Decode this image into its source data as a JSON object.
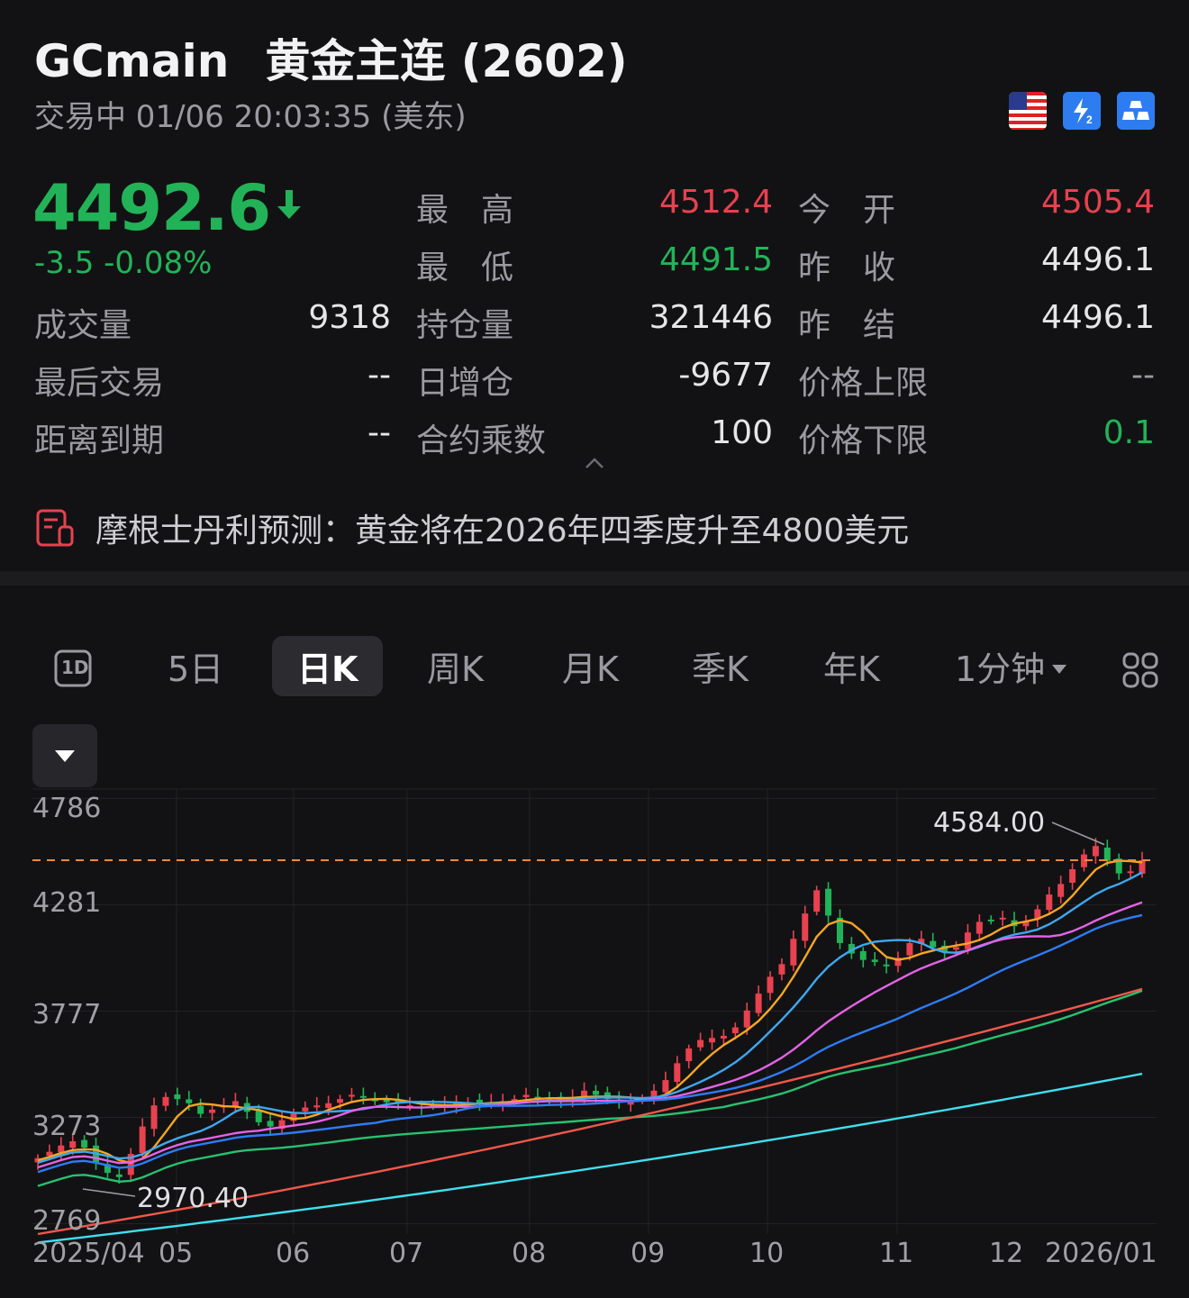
{
  "header": {
    "symbol": "GCmain",
    "name": "黄金主连 (2602)",
    "status_text": "交易中 01/06 20:03:35 (美东)",
    "badges": [
      "us-flag-icon",
      "level2-icon",
      "gold-bars-icon"
    ]
  },
  "quote": {
    "price": "4492.6",
    "change": "-3.5 -0.08%",
    "rows": {
      "high_label": "最　高",
      "high_value": "4512.4",
      "open_label": "今　开",
      "open_value": "4505.4",
      "low_label": "最　低",
      "low_value": "4491.5",
      "prevclose_label": "昨　收",
      "prevclose_value": "4496.1",
      "volume_label": "成交量",
      "volume_value": "9318",
      "oi_label": "持仓量",
      "oi_value": "321446",
      "prevsettle_label": "昨　结",
      "prevsettle_value": "4496.1",
      "lasttrade_label": "最后交易",
      "lasttrade_value": "--",
      "oichange_label": "日增仓",
      "oichange_value": "-9677",
      "upper_label": "价格上限",
      "upper_value": "--",
      "expiry_label": "距离到期",
      "expiry_value": "--",
      "multiplier_label": "合约乘数",
      "multiplier_value": "100",
      "lower_label": "价格下限",
      "lower_value": "0.1"
    }
  },
  "news": {
    "headline": "摩根士丹利预测：黄金将在2026年四季度升至4800美元"
  },
  "tabs": {
    "t1d": "1D",
    "t5d": "5日",
    "tday": "日K",
    "tweek": "周K",
    "tmonth": "月K",
    "tquarter": "季K",
    "tyear": "年K",
    "tmin": "1分钟",
    "active": "日K"
  },
  "colors": {
    "up": "#e8414f",
    "down": "#22b358",
    "ma5": "#f5a623",
    "ma10": "#3ea8f0",
    "ma20": "#e563e6",
    "ma30": "#2e7cf6",
    "ma60": "#27c270",
    "ma120": "#f0584a",
    "ma250": "#3fe0f0",
    "price_line": "#f08a3c"
  },
  "chart_data": {
    "type": "candlestick",
    "y_ticks": [
      "4786",
      "4281",
      "3777",
      "3273",
      "2769"
    ],
    "ylim": [
      2720,
      4830
    ],
    "x_labels": [
      "2025/04",
      "05",
      "06",
      "07",
      "08",
      "09",
      "10",
      "11",
      "12",
      "2026/01"
    ],
    "high_annotation": "4584.00",
    "low_annotation": "2970.40",
    "current_price_line": 4492.6,
    "closes": [
      3080,
      3110,
      3140,
      3160,
      3130,
      3060,
      3010,
      2990,
      3100,
      3230,
      3330,
      3370,
      3360,
      3340,
      3290,
      3310,
      3330,
      3350,
      3300,
      3250,
      3230,
      3260,
      3290,
      3320,
      3330,
      3340,
      3360,
      3380,
      3370,
      3350,
      3345,
      3340,
      3330,
      3320,
      3330,
      3335,
      3340,
      3345,
      3340,
      3345,
      3350,
      3360,
      3380,
      3370,
      3360,
      3350,
      3370,
      3400,
      3380,
      3360,
      3345,
      3350,
      3360,
      3400,
      3450,
      3530,
      3600,
      3640,
      3650,
      3660,
      3700,
      3780,
      3860,
      3940,
      4000,
      4120,
      4240,
      4350,
      4230,
      4100,
      4050,
      4020,
      4010,
      3990,
      4030,
      4100,
      4120,
      4080,
      4060,
      4080,
      4150,
      4200,
      4210,
      4220,
      4180,
      4200,
      4260,
      4330,
      4380,
      4450,
      4520,
      4560,
      4490,
      4430,
      4440,
      4492.6
    ],
    "series": [
      {
        "name": "MA5",
        "window": 5
      },
      {
        "name": "MA10",
        "window": 10
      },
      {
        "name": "MA20",
        "window": 20
      },
      {
        "name": "MA30",
        "window": 30
      },
      {
        "name": "MA60",
        "window": 60
      },
      {
        "name": "MA120",
        "start": 2720,
        "end": 3882
      },
      {
        "name": "MA250",
        "start": 2680,
        "end": 3480
      }
    ]
  }
}
